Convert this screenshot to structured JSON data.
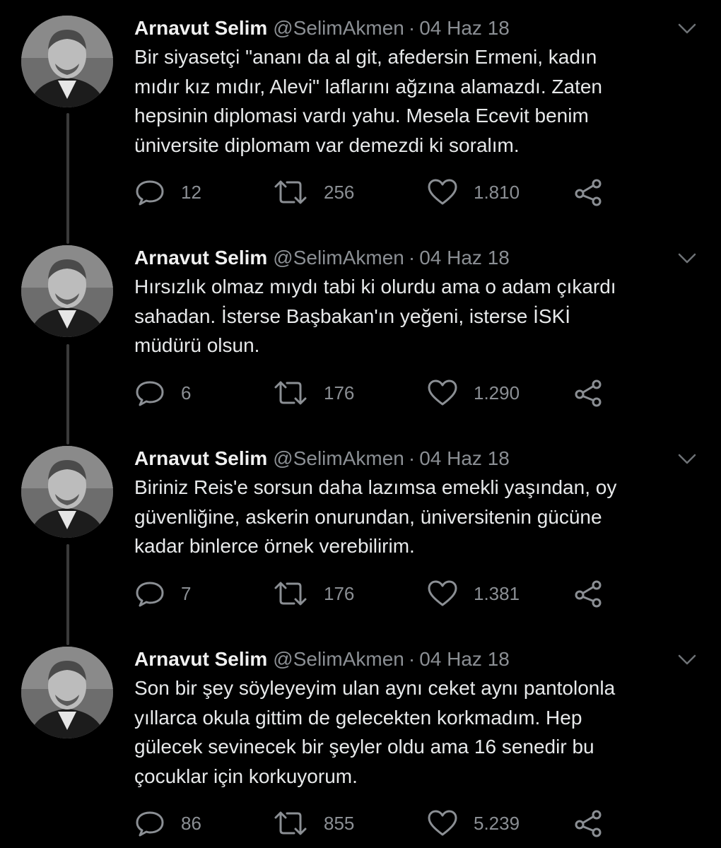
{
  "tweets": [
    {
      "name": "Arnavut Selim",
      "handle": "@SelimAkmen",
      "separator": "·",
      "date": "04 Haz 18",
      "lines": [
        "Bir siyasetçi \"ananı da al git, afedersin Ermeni, kadın",
        "mıdır kız mıdır, Alevi\" laflarını ağzına alamazdı. Zaten",
        "hepsinin diplomasi vardı yahu. Mesela Ecevit benim",
        "üniversite diplomam var demezdi ki soralım."
      ],
      "replies": "12",
      "retweets": "256",
      "likes": "1.810"
    },
    {
      "name": "Arnavut Selim",
      "handle": "@SelimAkmen",
      "separator": "·",
      "date": "04 Haz 18",
      "lines": [
        "Hırsızlık olmaz mıydı tabi ki olurdu ama o adam çıkardı",
        "sahadan. İsterse Başbakan'ın yeğeni, isterse İSKİ",
        "müdürü olsun."
      ],
      "replies": "6",
      "retweets": "176",
      "likes": "1.290"
    },
    {
      "name": "Arnavut Selim",
      "handle": "@SelimAkmen",
      "separator": "·",
      "date": "04 Haz 18",
      "lines": [
        "Biriniz Reis'e sorsun daha lazımsa emekli yaşından, oy",
        "güvenliğine, askerin onurundan, üniversitenin gücüne",
        "kadar binlerce örnek verebilirim."
      ],
      "replies": "7",
      "retweets": "176",
      "likes": "1.381"
    },
    {
      "name": "Arnavut Selim",
      "handle": "@SelimAkmen",
      "separator": "·",
      "date": "04 Haz 18",
      "lines": [
        "Son bir şey söyleyeyim ulan aynı ceket aynı pantolonla",
        "yıllarca okula gittim de gelecekten korkmadım. Hep",
        "gülecek sevinecek bir şeyler oldu ama 16 senedir bu",
        "çocuklar için korkuyorum."
      ],
      "replies": "86",
      "retweets": "855",
      "likes": "5.239"
    }
  ],
  "icons": {
    "reply": "reply-icon",
    "retweet": "retweet-icon",
    "like": "like-icon",
    "share": "share-icon",
    "caret": "chevron-down-icon"
  },
  "colors": {
    "background": "#000000",
    "text": "#e7e9ea",
    "muted": "#8b8f94",
    "thread_line": "#3a3a3a"
  }
}
